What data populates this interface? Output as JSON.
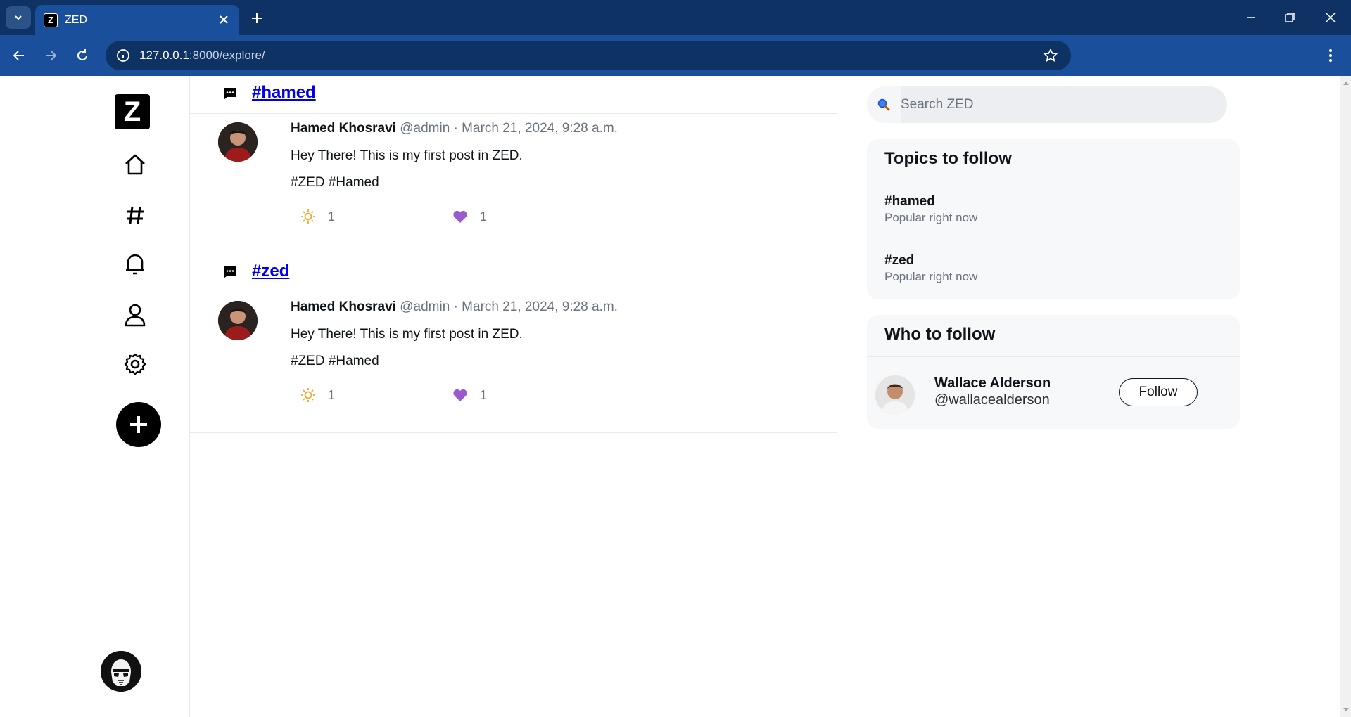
{
  "browser": {
    "tab_title": "ZED",
    "tab_favicon_letter": "Z",
    "url_host": "127.0.0.1",
    "url_rest": ":8000/explore/"
  },
  "sidebar": {
    "logo_letter": "Z",
    "items": [
      {
        "icon": "home-icon"
      },
      {
        "icon": "hashtag-icon"
      },
      {
        "icon": "bell-icon"
      },
      {
        "icon": "profile-icon"
      },
      {
        "icon": "gear-icon"
      }
    ],
    "compose_icon": "plus-icon"
  },
  "feed": {
    "topics": [
      {
        "tag": "#hamed",
        "post": {
          "author": "Hamed Khosravi",
          "handle": "@admin",
          "separator": "·",
          "date": "March 21, 2024, 9:28 a.m.",
          "text": "Hey There! This is my first post in ZED.",
          "tags": "#ZED #Hamed",
          "shine_count": "1",
          "like_count": "1"
        }
      },
      {
        "tag": "#zed",
        "post": {
          "author": "Hamed Khosravi",
          "handle": "@admin",
          "separator": "·",
          "date": "March 21, 2024, 9:28 a.m.",
          "text": "Hey There! This is my first post in ZED.",
          "tags": "#ZED #Hamed",
          "shine_count": "1",
          "like_count": "1"
        }
      }
    ]
  },
  "right": {
    "search_placeholder": "Search ZED",
    "topics_title": "Topics to follow",
    "topics": [
      {
        "name": "#hamed",
        "subtitle": "Popular right now"
      },
      {
        "name": "#zed",
        "subtitle": "Popular right now"
      }
    ],
    "who_title": "Who to follow",
    "who": {
      "name": "Wallace Alderson",
      "handle": "@wallacealderson",
      "button": "Follow"
    }
  },
  "colors": {
    "chrome_dark": "#0e3263",
    "chrome_toolbar": "#1a4f9c",
    "link": "#0000ee",
    "heart": "#9b59d0",
    "sun": "#f0a830"
  }
}
